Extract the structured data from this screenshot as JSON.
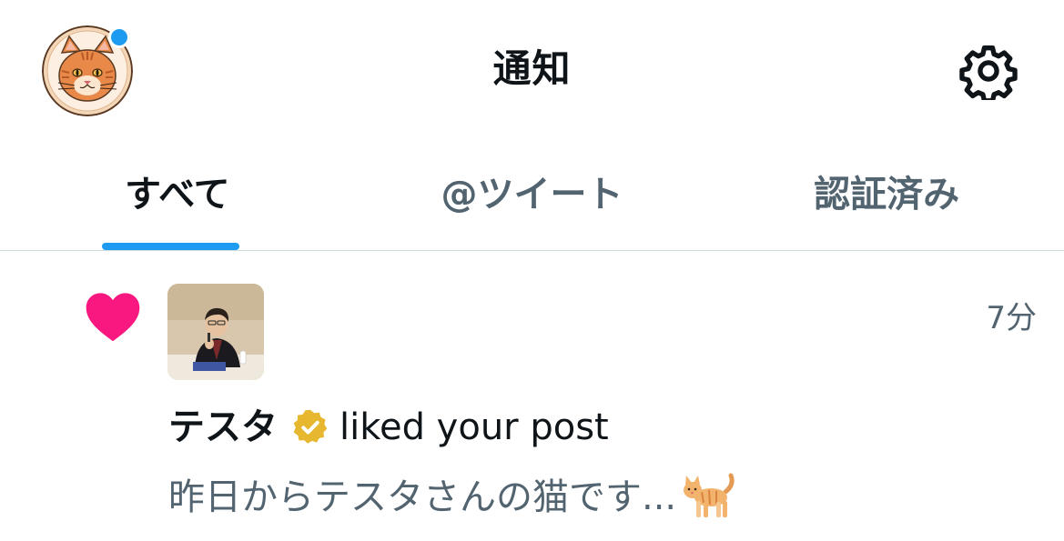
{
  "header": {
    "title": "通知",
    "avatar_icon": "cat-avatar-icon",
    "settings_icon": "gear-icon",
    "notification_dot_color": "#1d9bf0"
  },
  "tabs": [
    {
      "label": "すべて",
      "active": true
    },
    {
      "label": "@ツイート",
      "active": false
    },
    {
      "label": "認証済み",
      "active": false
    }
  ],
  "accent_color": "#1d9bf0",
  "notification": {
    "type_icon": "heart-icon",
    "type_color": "#f91880",
    "time": "7分",
    "actor_name": "テスタ",
    "verified_icon": "verified-badge-icon",
    "action": "liked your post",
    "preview_text": "昨日からテスタさんの猫です...",
    "preview_emoji_icon": "cat-emoji-icon"
  }
}
